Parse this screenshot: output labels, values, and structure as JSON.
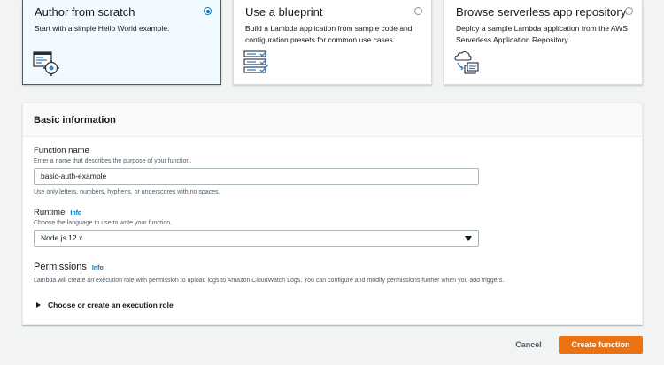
{
  "options": [
    {
      "title": "Author from scratch",
      "description": "Start with a simple Hello World example.",
      "selected": true,
      "icon": "code-gear-icon"
    },
    {
      "title": "Use a blueprint",
      "description": "Build a Lambda application from sample code and configuration presets for common use cases.",
      "selected": false,
      "icon": "blueprint-checklist-icon"
    },
    {
      "title": "Browse serverless app repository",
      "description": "Deploy a sample Lambda application from the AWS Serverless Application Repository.",
      "selected": false,
      "icon": "cloud-repository-icon"
    }
  ],
  "basic_info": {
    "header": "Basic information",
    "function_name": {
      "label": "Function name",
      "description": "Enter a name that describes the purpose of your function.",
      "value": "basic-auth-example",
      "constraint": "Use only letters, numbers, hyphens, or underscores with no spaces."
    },
    "runtime": {
      "label": "Runtime",
      "info": "Info",
      "description": "Choose the language to use to write your function.",
      "value": "Node.js 12.x"
    },
    "permissions": {
      "title": "Permissions",
      "info": "Info",
      "description": "Lambda will create an execution role with permission to upload logs to Amazon CloudWatch Logs. You can configure and modify permissions further when you add triggers.",
      "expander": "Choose or create an execution role"
    }
  },
  "actions": {
    "cancel": "Cancel",
    "create": "Create function"
  },
  "colors": {
    "accent": "#0073bb",
    "primary_button": "#ec7211",
    "background": "#f2f3f3"
  }
}
